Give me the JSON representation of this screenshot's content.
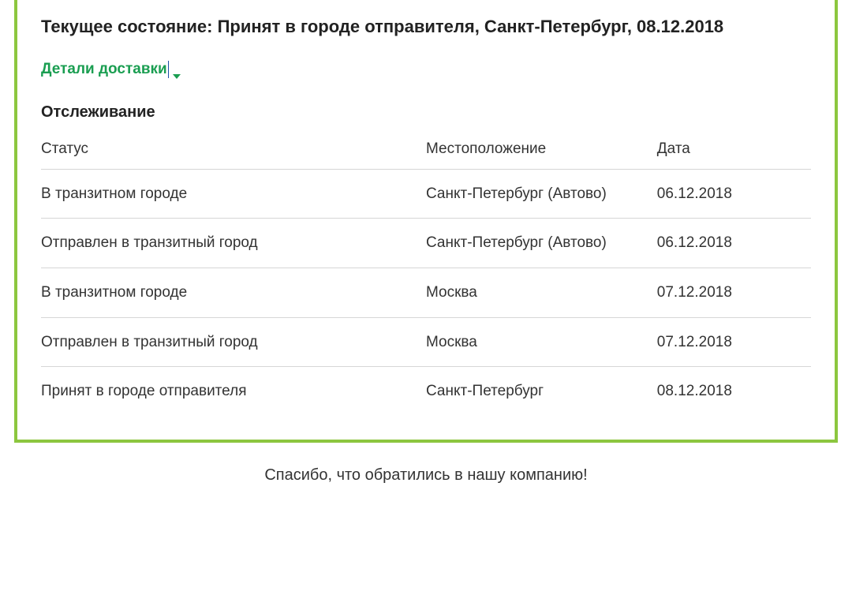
{
  "header": {
    "current_status_label": "Текущее состояние:",
    "current_status_value": "Принят в городе отправителя, Санкт-Петербург, 08.12.2018",
    "details_toggle_label": "Детали доставки"
  },
  "tracking": {
    "title": "Отслеживание",
    "columns": {
      "status": "Статус",
      "location": "Местоположение",
      "date": "Дата"
    },
    "rows": [
      {
        "status": "В транзитном городе",
        "location": "Санкт-Петербург (Автово)",
        "date": "06.12.2018"
      },
      {
        "status": "Отправлен в транзитный город",
        "location": "Санкт-Петербург (Автово)",
        "date": "06.12.2018"
      },
      {
        "status": "В транзитном городе",
        "location": "Москва",
        "date": "07.12.2018"
      },
      {
        "status": "Отправлен в транзитный город",
        "location": "Москва",
        "date": "07.12.2018"
      },
      {
        "status": "Принят в городе отправителя",
        "location": "Санкт-Петербург",
        "date": "08.12.2018"
      }
    ]
  },
  "footer": {
    "thank_you": "Спасибо, что обратились в нашу компанию!"
  }
}
